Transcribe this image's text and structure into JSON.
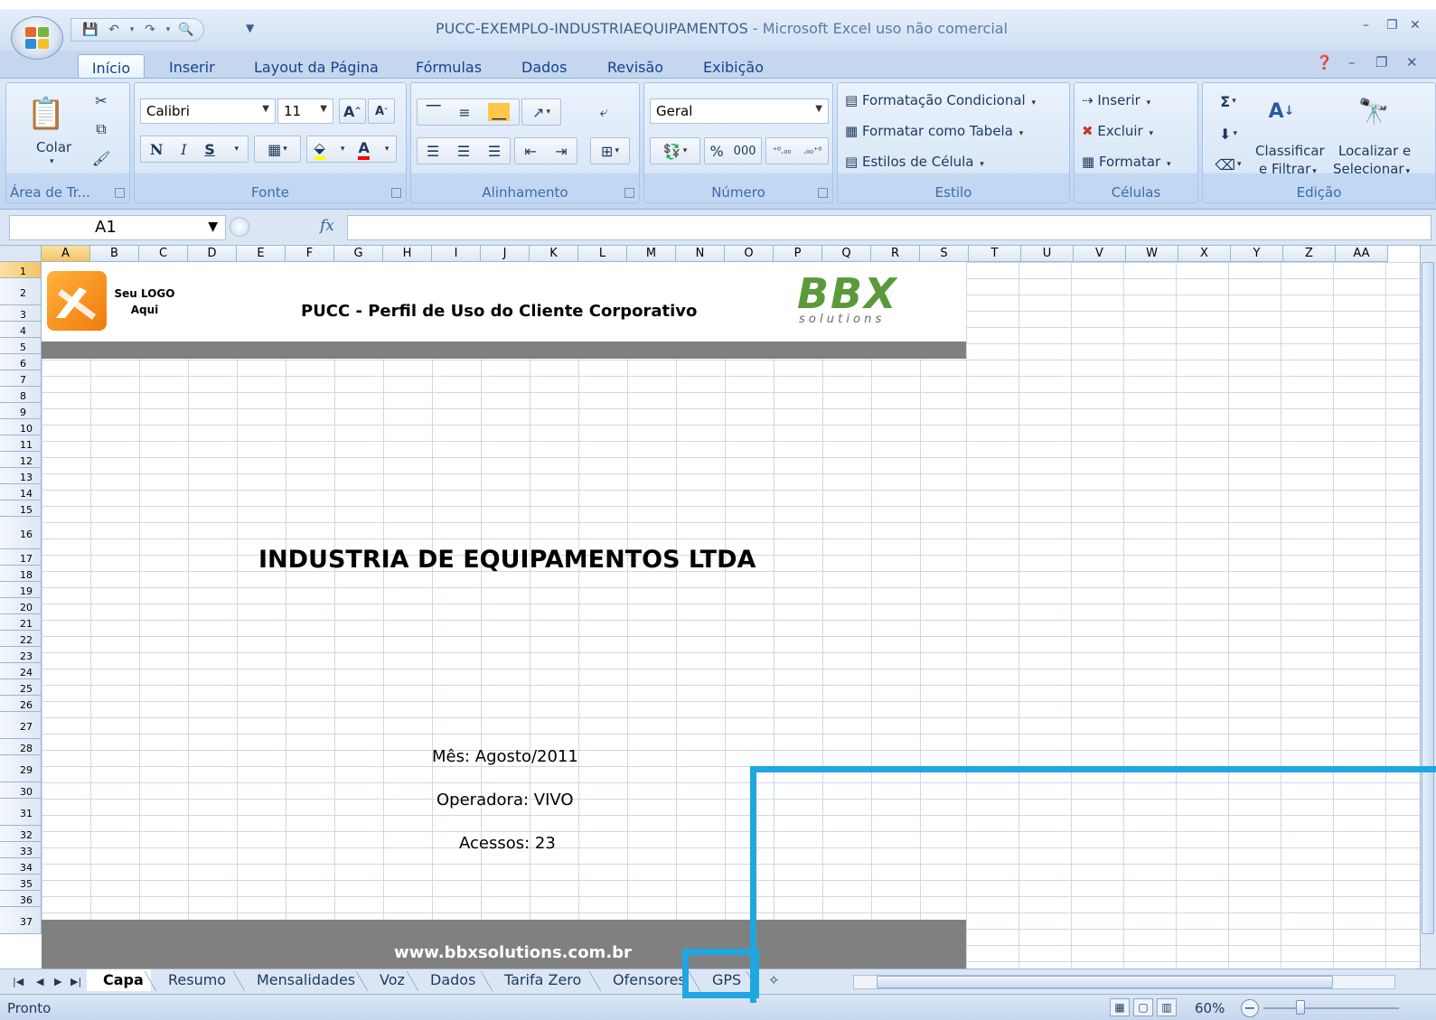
{
  "window": {
    "title_doc": "PUCC-EXEMPLO-INDUSTRIAEQUIPAMENTOS",
    "title_app": " - Microsoft Excel uso não comercial"
  },
  "ribbon_tabs": [
    "Início",
    "Inserir",
    "Layout da Página",
    "Fórmulas",
    "Dados",
    "Revisão",
    "Exibição"
  ],
  "clipboard": {
    "label": "Área de Tr...",
    "paste_label": "Colar"
  },
  "font": {
    "label": "Fonte",
    "name": "Calibri",
    "size": "11",
    "bold": "N",
    "italic": "I",
    "underline": "S"
  },
  "alignment": {
    "label": "Alinhamento"
  },
  "number": {
    "label": "Número",
    "format": "Geral",
    "percent": "%",
    "thousands": "000"
  },
  "styles": {
    "label": "Estilo",
    "conditional": "Formatação Condicional",
    "as_table": "Formatar como Tabela",
    "cell_styles": "Estilos de Célula"
  },
  "cells": {
    "label": "Células",
    "insert": "Inserir",
    "delete": "Excluir",
    "format": "Formatar"
  },
  "editing": {
    "label": "Edição",
    "sort_l1": "Classificar",
    "sort_l2": "e Filtrar",
    "find_l1": "Localizar e",
    "find_l2": "Selecionar"
  },
  "formula_bar": {
    "name_box": "A1",
    "formula": ""
  },
  "columns": [
    "A",
    "B",
    "C",
    "D",
    "E",
    "F",
    "G",
    "H",
    "I",
    "J",
    "K",
    "L",
    "M",
    "N",
    "O",
    "P",
    "Q",
    "R",
    "S",
    "T",
    "U",
    "V",
    "W",
    "X",
    "Y",
    "Z",
    "AA"
  ],
  "rows": [
    "1",
    "2",
    "3",
    "4",
    "5",
    "6",
    "7",
    "8",
    "9",
    "10",
    "11",
    "12",
    "13",
    "14",
    "15",
    "16",
    "17",
    "18",
    "19",
    "20",
    "21",
    "22",
    "23",
    "24",
    "25",
    "26",
    "27",
    "28",
    "29",
    "30",
    "31",
    "32",
    "33",
    "34",
    "35",
    "36",
    "37"
  ],
  "sheet": {
    "logo_l1": "Seu LOGO",
    "logo_l2": "Aqui",
    "header_title": "PUCC - Perfil de Uso do Cliente Corporativo",
    "bbx_logo": "BBX",
    "bbx_tag": "s o l u t i o n s",
    "company": "INDUSTRIA DE EQUIPAMENTOS LTDA",
    "month": "Mês: Agosto/2011",
    "operator": "Operadora: VIVO",
    "accesses": "Acessos: 23",
    "footer_url": "www.bbxsolutions.com.br"
  },
  "sheet_tabs": [
    "Capa",
    "Resumo",
    "Mensalidades",
    "Voz",
    "Dados",
    "Tarifa Zero",
    "Ofensores",
    "GPS"
  ],
  "status": {
    "text": "Pronto",
    "zoom": "60%"
  },
  "colors": {
    "highlight": "#1ea7e1",
    "band": "#808080",
    "ribbon": "#c5d7ee"
  }
}
